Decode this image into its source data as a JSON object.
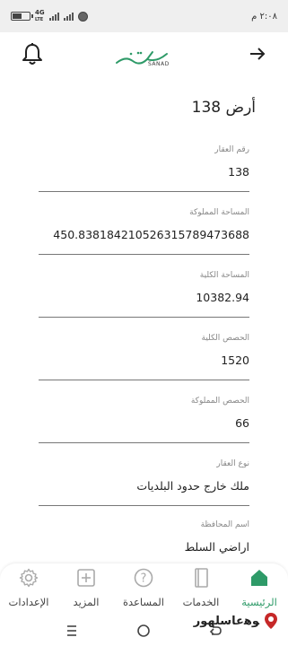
{
  "status_bar": {
    "time": "٢:٠٨ م",
    "network": "4G",
    "network_sub": "LTE",
    "battery_percent": 60
  },
  "app_bar": {
    "brand": "SANAD",
    "back_icon": "arrow-right-icon",
    "bell_icon": "bell-icon"
  },
  "page": {
    "title": "أرض 138"
  },
  "fields": [
    {
      "label": "رقم العقار",
      "value": "138"
    },
    {
      "label": "المساحة المملوكة",
      "value": "450.838184210526315789473688"
    },
    {
      "label": "المساحة الكلية",
      "value": "10382.94"
    },
    {
      "label": "الحصص الكلية",
      "value": "1520"
    },
    {
      "label": "الحصص المملوكة",
      "value": "66"
    },
    {
      "label": "نوع العقار",
      "value": "ملك خارج حدود البلديات"
    },
    {
      "label": "اسم المحافظة",
      "value": "اراضي السلط"
    }
  ],
  "bottom_nav": [
    {
      "label": "الرئيسية",
      "icon": "home-icon",
      "active": true
    },
    {
      "label": "الخدمات",
      "icon": "services-icon",
      "active": false
    },
    {
      "label": "المساعدة",
      "icon": "help-icon",
      "active": false
    },
    {
      "label": "المزيد",
      "icon": "plus-square-icon",
      "active": false
    },
    {
      "label": "الإعدادات",
      "icon": "gear-icon",
      "active": false
    }
  ],
  "watermark": {
    "text": "ﻮﻫﻋﺎﺳﻠﻬﻮﺭ"
  },
  "colors": {
    "accent": "#2e9a68",
    "status_bar": "#efefef",
    "text": "#222222",
    "label": "#888888"
  }
}
